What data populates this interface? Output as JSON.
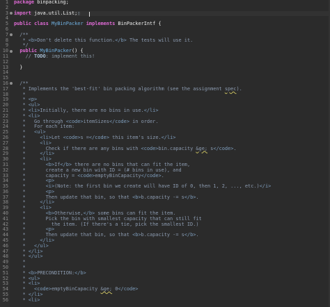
{
  "editor": {
    "language": "java",
    "file_package": "binpacking",
    "colors": {
      "background": "#2b2b2b",
      "keyword": "#cc7832",
      "javadoc": "#8c9bb0",
      "class_name": "#70b0e0"
    }
  },
  "lines": [
    {
      "n": "1",
      "marker": false,
      "tokens": [
        {
          "t": "package",
          "c": "t-kwp"
        },
        {
          "t": " binpacking;",
          "c": "t-id"
        }
      ]
    },
    {
      "n": "2",
      "marker": false,
      "tokens": []
    },
    {
      "n": "3",
      "marker": true,
      "tokens": [
        {
          "t": "import",
          "c": "t-kwp"
        },
        {
          "t": " java.util.List;",
          "c": "t-id"
        },
        {
          "t": "▯",
          "c": "t-cm"
        }
      ]
    },
    {
      "n": "4",
      "marker": false,
      "tokens": []
    },
    {
      "n": "5",
      "marker": false,
      "tokens": [
        {
          "t": "public",
          "c": "t-kwp"
        },
        {
          "t": " ",
          "c": ""
        },
        {
          "t": "class",
          "c": "t-kwp"
        },
        {
          "t": " ",
          "c": ""
        },
        {
          "t": "MyBinPacker",
          "c": "t-cls"
        },
        {
          "t": " ",
          "c": ""
        },
        {
          "t": "implements",
          "c": "t-kwp"
        },
        {
          "t": " ",
          "c": ""
        },
        {
          "t": "BinPackerIntf",
          "c": "t-id"
        },
        {
          "t": " {",
          "c": "t-id"
        }
      ]
    },
    {
      "n": "6",
      "marker": false,
      "tokens": []
    },
    {
      "n": "7",
      "marker": true,
      "tokens": [
        {
          "t": "  /**",
          "c": "t-jdoc"
        }
      ]
    },
    {
      "n": "8",
      "marker": false,
      "tokens": [
        {
          "t": "   * ",
          "c": "t-jdoc"
        },
        {
          "t": "<b>",
          "c": "t-tag"
        },
        {
          "t": "Don't delete this function.",
          "c": "t-jdoc"
        },
        {
          "t": "</b>",
          "c": "t-tag"
        },
        {
          "t": " The tests will use it.",
          "c": "t-jdoc"
        }
      ]
    },
    {
      "n": "9",
      "marker": false,
      "tokens": [
        {
          "t": "   */",
          "c": "t-jdoc"
        }
      ]
    },
    {
      "n": "10",
      "marker": true,
      "tokens": [
        {
          "t": "  ",
          "c": ""
        },
        {
          "t": "public",
          "c": "t-kwp"
        },
        {
          "t": " ",
          "c": ""
        },
        {
          "t": "MyBinPacker",
          "c": "t-cls"
        },
        {
          "t": "() {",
          "c": "t-id"
        }
      ]
    },
    {
      "n": "11",
      "marker": false,
      "tokens": [
        {
          "t": "    // ",
          "c": "t-cm"
        },
        {
          "t": "TODO",
          "c": "t-todo"
        },
        {
          "t": ": implement this!",
          "c": "t-cm"
        }
      ]
    },
    {
      "n": "12",
      "marker": false,
      "tokens": []
    },
    {
      "n": "13",
      "marker": false,
      "tokens": [
        {
          "t": "  }",
          "c": "t-id"
        }
      ]
    },
    {
      "n": "14",
      "marker": false,
      "tokens": []
    },
    {
      "n": "15",
      "marker": false,
      "tokens": []
    },
    {
      "n": "16",
      "marker": true,
      "tokens": [
        {
          "t": "  /**",
          "c": "t-jdoc"
        }
      ]
    },
    {
      "n": "17",
      "marker": false,
      "tokens": [
        {
          "t": "   * Implements the 'best-fit' bin packing algorithm (see the assignment ",
          "c": "t-jdoc"
        },
        {
          "t": "spec",
          "c": "t-jdoc t-sq"
        },
        {
          "t": ").",
          "c": "t-jdoc"
        }
      ]
    },
    {
      "n": "18",
      "marker": false,
      "tokens": [
        {
          "t": "   *",
          "c": "t-jdoc"
        }
      ]
    },
    {
      "n": "19",
      "marker": false,
      "tokens": [
        {
          "t": "   * ",
          "c": "t-jdoc"
        },
        {
          "t": "<p>",
          "c": "t-tag"
        }
      ]
    },
    {
      "n": "20",
      "marker": false,
      "tokens": [
        {
          "t": "   * ",
          "c": "t-jdoc"
        },
        {
          "t": "<ul>",
          "c": "t-tag"
        }
      ]
    },
    {
      "n": "21",
      "marker": false,
      "tokens": [
        {
          "t": "   * ",
          "c": "t-jdoc"
        },
        {
          "t": "<li>",
          "c": "t-tag"
        },
        {
          "t": "Initially, there are no bins in use.",
          "c": "t-jdoc"
        },
        {
          "t": "</li>",
          "c": "t-tag"
        }
      ]
    },
    {
      "n": "22",
      "marker": false,
      "tokens": [
        {
          "t": "   * ",
          "c": "t-jdoc"
        },
        {
          "t": "<li>",
          "c": "t-tag"
        }
      ]
    },
    {
      "n": "23",
      "marker": false,
      "tokens": [
        {
          "t": "   *   Go through ",
          "c": "t-jdoc"
        },
        {
          "t": "<code>",
          "c": "t-tag"
        },
        {
          "t": "itemSizes",
          "c": "t-jdoc"
        },
        {
          "t": "</code>",
          "c": "t-tag"
        },
        {
          "t": " in order.",
          "c": "t-jdoc"
        }
      ]
    },
    {
      "n": "24",
      "marker": false,
      "tokens": [
        {
          "t": "   *   For each item:",
          "c": "t-jdoc"
        }
      ]
    },
    {
      "n": "25",
      "marker": false,
      "tokens": [
        {
          "t": "   *   ",
          "c": "t-jdoc"
        },
        {
          "t": "<ul>",
          "c": "t-tag"
        }
      ]
    },
    {
      "n": "26",
      "marker": false,
      "tokens": [
        {
          "t": "   *     ",
          "c": "t-jdoc"
        },
        {
          "t": "<li>",
          "c": "t-tag"
        },
        {
          "t": "Let ",
          "c": "t-jdoc"
        },
        {
          "t": "<code>",
          "c": "t-tag"
        },
        {
          "t": "s =",
          "c": "t-jdoc"
        },
        {
          "t": "</code>",
          "c": "t-tag"
        },
        {
          "t": " this item's size.",
          "c": "t-jdoc"
        },
        {
          "t": "</li>",
          "c": "t-tag"
        }
      ]
    },
    {
      "n": "27",
      "marker": false,
      "tokens": [
        {
          "t": "   *     ",
          "c": "t-jdoc"
        },
        {
          "t": "<li>",
          "c": "t-tag"
        }
      ]
    },
    {
      "n": "28",
      "marker": false,
      "tokens": [
        {
          "t": "   *       Check if there are any bins with ",
          "c": "t-jdoc"
        },
        {
          "t": "<code>",
          "c": "t-tag"
        },
        {
          "t": "bin.capacity ",
          "c": "t-jdoc"
        },
        {
          "t": "&ge;",
          "c": "t-jdoc t-sq"
        },
        {
          "t": " s",
          "c": "t-jdoc"
        },
        {
          "t": "</code>",
          "c": "t-tag"
        },
        {
          "t": ".",
          "c": "t-jdoc"
        }
      ]
    },
    {
      "n": "29",
      "marker": false,
      "tokens": [
        {
          "t": "   *     ",
          "c": "t-jdoc"
        },
        {
          "t": "</li>",
          "c": "t-tag"
        }
      ]
    },
    {
      "n": "30",
      "marker": false,
      "tokens": [
        {
          "t": "   *     ",
          "c": "t-jdoc"
        },
        {
          "t": "<li>",
          "c": "t-tag"
        }
      ]
    },
    {
      "n": "31",
      "marker": false,
      "tokens": [
        {
          "t": "   *       ",
          "c": "t-jdoc"
        },
        {
          "t": "<b>",
          "c": "t-tag"
        },
        {
          "t": "If",
          "c": "t-jdoc"
        },
        {
          "t": "</b>",
          "c": "t-tag"
        },
        {
          "t": " there are no bins that can fit the item,",
          "c": "t-jdoc"
        }
      ]
    },
    {
      "n": "32",
      "marker": false,
      "tokens": [
        {
          "t": "   *       create a new bin with ID = (# bins in use), and",
          "c": "t-jdoc"
        }
      ]
    },
    {
      "n": "33",
      "marker": false,
      "tokens": [
        {
          "t": "   *       capacity = ",
          "c": "t-jdoc"
        },
        {
          "t": "<code>",
          "c": "t-tag"
        },
        {
          "t": "emptyBinCapacity",
          "c": "t-jdoc"
        },
        {
          "t": "</code>",
          "c": "t-tag"
        },
        {
          "t": ".",
          "c": "t-jdoc"
        }
      ]
    },
    {
      "n": "34",
      "marker": false,
      "tokens": [
        {
          "t": "   *       ",
          "c": "t-jdoc"
        },
        {
          "t": "<p>",
          "c": "t-tag"
        }
      ]
    },
    {
      "n": "35",
      "marker": false,
      "tokens": [
        {
          "t": "   *       ",
          "c": "t-jdoc"
        },
        {
          "t": "<i>",
          "c": "t-tag"
        },
        {
          "t": "(Note: the first bin we create will have ID of 0, then 1, 2, ..., etc.)",
          "c": "t-jdoc"
        },
        {
          "t": "</i>",
          "c": "t-tag"
        }
      ]
    },
    {
      "n": "36",
      "marker": false,
      "tokens": [
        {
          "t": "   *       ",
          "c": "t-jdoc"
        },
        {
          "t": "<p>",
          "c": "t-tag"
        }
      ]
    },
    {
      "n": "37",
      "marker": false,
      "tokens": [
        {
          "t": "   *       Then update that bin, so that ",
          "c": "t-jdoc"
        },
        {
          "t": "<b>",
          "c": "t-tag"
        },
        {
          "t": "b.capacity -= s",
          "c": "t-jdoc"
        },
        {
          "t": "</b>",
          "c": "t-tag"
        },
        {
          "t": ".",
          "c": "t-jdoc"
        }
      ]
    },
    {
      "n": "38",
      "marker": false,
      "tokens": [
        {
          "t": "   *     ",
          "c": "t-jdoc"
        },
        {
          "t": "</li>",
          "c": "t-tag"
        }
      ]
    },
    {
      "n": "39",
      "marker": false,
      "tokens": [
        {
          "t": "   *     ",
          "c": "t-jdoc"
        },
        {
          "t": "<li>",
          "c": "t-tag"
        }
      ]
    },
    {
      "n": "40",
      "marker": false,
      "tokens": [
        {
          "t": "   *       ",
          "c": "t-jdoc"
        },
        {
          "t": "<b>",
          "c": "t-tag"
        },
        {
          "t": "Otherwise,",
          "c": "t-jdoc"
        },
        {
          "t": "</b>",
          "c": "t-tag"
        },
        {
          "t": " some bins can fit the item.",
          "c": "t-jdoc"
        }
      ]
    },
    {
      "n": "41",
      "marker": false,
      "tokens": [
        {
          "t": "   *       Pick the bin with smallest capacity that can still fit",
          "c": "t-jdoc"
        }
      ]
    },
    {
      "n": "42",
      "marker": false,
      "tokens": [
        {
          "t": "   *         the item. (If there's a tie, pick the smallest ID.)",
          "c": "t-jdoc"
        }
      ]
    },
    {
      "n": "43",
      "marker": false,
      "tokens": [
        {
          "t": "   *       ",
          "c": "t-jdoc"
        },
        {
          "t": "<p>",
          "c": "t-tag"
        }
      ]
    },
    {
      "n": "44",
      "marker": false,
      "tokens": [
        {
          "t": "   *       Then update that bin, so that ",
          "c": "t-jdoc"
        },
        {
          "t": "<b>",
          "c": "t-tag"
        },
        {
          "t": "b.capacity -= s",
          "c": "t-jdoc"
        },
        {
          "t": "</b>",
          "c": "t-tag"
        },
        {
          "t": ".",
          "c": "t-jdoc"
        }
      ]
    },
    {
      "n": "45",
      "marker": false,
      "tokens": [
        {
          "t": "   *     ",
          "c": "t-jdoc"
        },
        {
          "t": "</li>",
          "c": "t-tag"
        }
      ]
    },
    {
      "n": "46",
      "marker": false,
      "tokens": [
        {
          "t": "   *   ",
          "c": "t-jdoc"
        },
        {
          "t": "</ul>",
          "c": "t-tag"
        }
      ]
    },
    {
      "n": "47",
      "marker": false,
      "tokens": [
        {
          "t": "   * ",
          "c": "t-jdoc"
        },
        {
          "t": "</li>",
          "c": "t-tag"
        }
      ]
    },
    {
      "n": "48",
      "marker": false,
      "tokens": [
        {
          "t": "   * ",
          "c": "t-jdoc"
        },
        {
          "t": "</ul>",
          "c": "t-tag"
        }
      ]
    },
    {
      "n": "49",
      "marker": false,
      "tokens": [
        {
          "t": "   *",
          "c": "t-jdoc"
        }
      ]
    },
    {
      "n": "50",
      "marker": false,
      "tokens": [
        {
          "t": "   *",
          "c": "t-jdoc"
        }
      ]
    },
    {
      "n": "51",
      "marker": false,
      "tokens": [
        {
          "t": "   * ",
          "c": "t-jdoc"
        },
        {
          "t": "<b>",
          "c": "t-tag"
        },
        {
          "t": "PRECONDITION:",
          "c": "t-jdoc"
        },
        {
          "t": "</b>",
          "c": "t-tag"
        }
      ]
    },
    {
      "n": "52",
      "marker": false,
      "tokens": [
        {
          "t": "   * ",
          "c": "t-jdoc"
        },
        {
          "t": "<ul>",
          "c": "t-tag"
        }
      ]
    },
    {
      "n": "53",
      "marker": false,
      "tokens": [
        {
          "t": "   * ",
          "c": "t-jdoc"
        },
        {
          "t": "<li>",
          "c": "t-tag"
        }
      ]
    },
    {
      "n": "54",
      "marker": false,
      "tokens": [
        {
          "t": "   *   ",
          "c": "t-jdoc"
        },
        {
          "t": "<code>",
          "c": "t-tag"
        },
        {
          "t": "emptyBinCapacity ",
          "c": "t-jdoc"
        },
        {
          "t": "&ge;",
          "c": "t-jdoc t-sq"
        },
        {
          "t": " 0",
          "c": "t-jdoc"
        },
        {
          "t": "</code>",
          "c": "t-tag"
        }
      ]
    },
    {
      "n": "55",
      "marker": false,
      "tokens": [
        {
          "t": "   * ",
          "c": "t-jdoc"
        },
        {
          "t": "</li>",
          "c": "t-tag"
        }
      ]
    },
    {
      "n": "56",
      "marker": false,
      "tokens": [
        {
          "t": "   * ",
          "c": "t-jdoc"
        },
        {
          "t": "<li>",
          "c": "t-tag"
        }
      ]
    }
  ]
}
